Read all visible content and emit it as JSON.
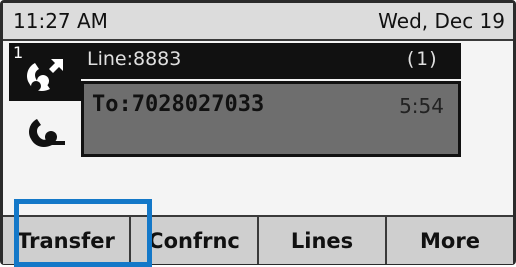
{
  "status": {
    "time": "11:27 AM",
    "date": "Wed, Dec 19"
  },
  "line": {
    "number": "1",
    "label": "Line:8883",
    "call_count": "(1)"
  },
  "call": {
    "to": "To:7028027033",
    "duration": "5:54"
  },
  "softkeys": {
    "transfer": "Transfer",
    "conference": "Confrnc",
    "lines": "Lines",
    "more": "More"
  },
  "icons": {
    "active_line": "phone-handset-active-icon",
    "call_state": "phone-handset-icon"
  },
  "colors": {
    "highlight": "#1478c8"
  }
}
